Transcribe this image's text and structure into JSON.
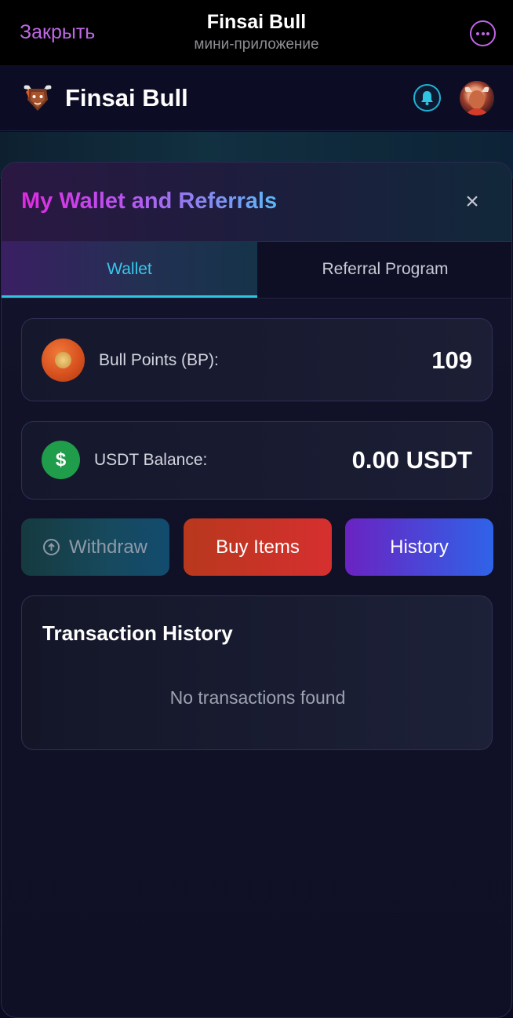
{
  "telegram_bar": {
    "close_label": "Закрыть",
    "title": "Finsai Bull",
    "subtitle": "мини-приложение",
    "more_icon": "more-icon"
  },
  "header": {
    "app_name": "Finsai Bull",
    "logo_icon": "bull-logo-icon",
    "notification_icon": "bell-icon",
    "avatar_icon": "user-avatar"
  },
  "modal": {
    "title": "My Wallet and Referrals",
    "close_label": "×",
    "tabs": [
      {
        "label": "Wallet",
        "active": true
      },
      {
        "label": "Referral Program",
        "active": false
      }
    ],
    "bull_points": {
      "label": "Bull Points (BP):",
      "value": "109"
    },
    "usdt": {
      "icon_label": "$",
      "label": "USDT Balance:",
      "value": "0.00 USDT"
    },
    "buttons": {
      "withdraw": "Withdraw",
      "buy": "Buy Items",
      "history": "History"
    },
    "transactions": {
      "title": "Transaction History",
      "empty": "No transactions found"
    }
  },
  "colors": {
    "accent_purple": "#c067e6",
    "accent_cyan": "#2fc4e0",
    "buy_red": "#d62f2f",
    "history_blue": "#2f63e8"
  }
}
